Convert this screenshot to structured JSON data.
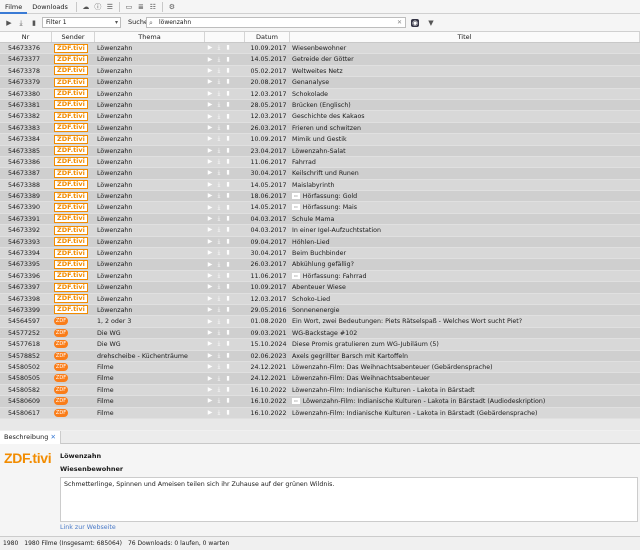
{
  "tabs": {
    "filme": "Filme",
    "downloads": "Downloads"
  },
  "filter": {
    "label": "Filter 1"
  },
  "search": {
    "label": "Suche:",
    "value": "löwenzahn"
  },
  "columns": {
    "nr": "Nr",
    "sender": "Sender",
    "thema": "Thema",
    "datum": "Datum",
    "titel": "Titel"
  },
  "rows": [
    {
      "nr": "54673376",
      "sender": "ZDF.tivi",
      "thema": "Löwenzahn",
      "datum": "10.09.2017",
      "titel": "Wiesenbewohner",
      "sub": false
    },
    {
      "nr": "54673377",
      "sender": "ZDF.tivi",
      "thema": "Löwenzahn",
      "datum": "14.05.2017",
      "titel": "Getreide der Götter",
      "sub": false
    },
    {
      "nr": "54673378",
      "sender": "ZDF.tivi",
      "thema": "Löwenzahn",
      "datum": "05.02.2017",
      "titel": "Weltweites Netz",
      "sub": false
    },
    {
      "nr": "54673379",
      "sender": "ZDF.tivi",
      "thema": "Löwenzahn",
      "datum": "20.08.2017",
      "titel": "Genanalyse",
      "sub": false
    },
    {
      "nr": "54673380",
      "sender": "ZDF.tivi",
      "thema": "Löwenzahn",
      "datum": "12.03.2017",
      "titel": "Schokolade",
      "sub": false
    },
    {
      "nr": "54673381",
      "sender": "ZDF.tivi",
      "thema": "Löwenzahn",
      "datum": "28.05.2017",
      "titel": "Brücken (Englisch)",
      "sub": false
    },
    {
      "nr": "54673382",
      "sender": "ZDF.tivi",
      "thema": "Löwenzahn",
      "datum": "12.03.2017",
      "titel": "Geschichte des Kakaos",
      "sub": false
    },
    {
      "nr": "54673383",
      "sender": "ZDF.tivi",
      "thema": "Löwenzahn",
      "datum": "26.03.2017",
      "titel": "Frieren und schwitzen",
      "sub": false
    },
    {
      "nr": "54673384",
      "sender": "ZDF.tivi",
      "thema": "Löwenzahn",
      "datum": "10.09.2017",
      "titel": "Mimik und Gestik",
      "sub": false
    },
    {
      "nr": "54673385",
      "sender": "ZDF.tivi",
      "thema": "Löwenzahn",
      "datum": "23.04.2017",
      "titel": "Löwenzahn-Salat",
      "sub": false
    },
    {
      "nr": "54673386",
      "sender": "ZDF.tivi",
      "thema": "Löwenzahn",
      "datum": "11.06.2017",
      "titel": "Fahrrad",
      "sub": false
    },
    {
      "nr": "54673387",
      "sender": "ZDF.tivi",
      "thema": "Löwenzahn",
      "datum": "30.04.2017",
      "titel": "Keilschrift und Runen",
      "sub": false
    },
    {
      "nr": "54673388",
      "sender": "ZDF.tivi",
      "thema": "Löwenzahn",
      "datum": "14.05.2017",
      "titel": "Maislabyrinth",
      "sub": false
    },
    {
      "nr": "54673389",
      "sender": "ZDF.tivi",
      "thema": "Löwenzahn",
      "datum": "18.06.2017",
      "titel": "Hörfassung: Gold",
      "sub": true
    },
    {
      "nr": "54673390",
      "sender": "ZDF.tivi",
      "thema": "Löwenzahn",
      "datum": "14.05.2017",
      "titel": "Hörfassung: Mais",
      "sub": true
    },
    {
      "nr": "54673391",
      "sender": "ZDF.tivi",
      "thema": "Löwenzahn",
      "datum": "04.03.2017",
      "titel": "Schule Mama",
      "sub": false
    },
    {
      "nr": "54673392",
      "sender": "ZDF.tivi",
      "thema": "Löwenzahn",
      "datum": "04.03.2017",
      "titel": "In einer Igel-Aufzuchtstation",
      "sub": false
    },
    {
      "nr": "54673393",
      "sender": "ZDF.tivi",
      "thema": "Löwenzahn",
      "datum": "09.04.2017",
      "titel": "Höhlen-Lied",
      "sub": false
    },
    {
      "nr": "54673394",
      "sender": "ZDF.tivi",
      "thema": "Löwenzahn",
      "datum": "30.04.2017",
      "titel": "Beim Buchbinder",
      "sub": false
    },
    {
      "nr": "54673395",
      "sender": "ZDF.tivi",
      "thema": "Löwenzahn",
      "datum": "26.03.2017",
      "titel": "Abkühlung gefällig?",
      "sub": false
    },
    {
      "nr": "54673396",
      "sender": "ZDF.tivi",
      "thema": "Löwenzahn",
      "datum": "11.06.2017",
      "titel": "Hörfassung: Fahrrad",
      "sub": true
    },
    {
      "nr": "54673397",
      "sender": "ZDF.tivi",
      "thema": "Löwenzahn",
      "datum": "10.09.2017",
      "titel": "Abenteuer Wiese",
      "sub": false
    },
    {
      "nr": "54673398",
      "sender": "ZDF.tivi",
      "thema": "Löwenzahn",
      "datum": "12.03.2017",
      "titel": "Schoko-Lied",
      "sub": false
    },
    {
      "nr": "54673399",
      "sender": "ZDF.tivi",
      "thema": "Löwenzahn",
      "datum": "29.05.2016",
      "titel": "Sonnenenergie",
      "sub": false
    },
    {
      "nr": "54564597",
      "sender": "ZDF",
      "thema": "1, 2 oder 3",
      "datum": "01.08.2020",
      "titel": "Ein Wort, zwei Bedeutungen: Piets Rätselspaß - Welches Wort sucht Piet?",
      "sub": false
    },
    {
      "nr": "54577252",
      "sender": "ZDF",
      "thema": "Die WG",
      "datum": "09.03.2021",
      "titel": "WG-Backstage #102",
      "sub": false
    },
    {
      "nr": "54577618",
      "sender": "ZDF",
      "thema": "Die WG",
      "datum": "15.10.2024",
      "titel": "Diese Promis gratulieren zum WG-Jubiläum (5)",
      "sub": false
    },
    {
      "nr": "54578852",
      "sender": "ZDF",
      "thema": "drehscheibe - Küchenträume",
      "datum": "02.06.2023",
      "titel": "Axels gegrillter Barsch mit Kartoffeln",
      "sub": false
    },
    {
      "nr": "54580502",
      "sender": "ZDF",
      "thema": "Filme",
      "datum": "24.12.2021",
      "titel": "Löwenzahn-Film: Das Weihnachtsabenteuer (Gebärdensprache)",
      "sub": false
    },
    {
      "nr": "54580505",
      "sender": "ZDF",
      "thema": "Filme",
      "datum": "24.12.2021",
      "titel": "Löwenzahn-Film: Das Weihnachtsabenteuer",
      "sub": false
    },
    {
      "nr": "54580582",
      "sender": "ZDF",
      "thema": "Filme",
      "datum": "16.10.2022",
      "titel": "Löwenzahn-Film: Indianische Kulturen - Lakota in Bärstadt",
      "sub": false
    },
    {
      "nr": "54580609",
      "sender": "ZDF",
      "thema": "Filme",
      "datum": "16.10.2022",
      "titel": "Löwenzahn-Film: Indianische Kulturen - Lakota in Bärstadt (Audiodeskription)",
      "sub": true
    },
    {
      "nr": "54580617",
      "sender": "ZDF",
      "thema": "Filme",
      "datum": "16.10.2022",
      "titel": "Löwenzahn-Film: Indianische Kulturen - Lakota in Bärstadt (Gebärdensprache)",
      "sub": false
    }
  ],
  "description": {
    "tab": "Beschreibung",
    "logo": "ZDF.tivi",
    "thema": "Löwenzahn",
    "titel": "Wiesenbewohner",
    "text": "Schmetterlinge, Spinnen und Ameisen teilen sich ihr Zuhause auf der grünen Wildnis.",
    "link": "Link zur Webseite"
  },
  "status": {
    "count": "1980",
    "filme": "1980 Filme (Insgesamt: 685064)",
    "downloads": "76 Downloads: 0 laufen, 0 warten"
  }
}
